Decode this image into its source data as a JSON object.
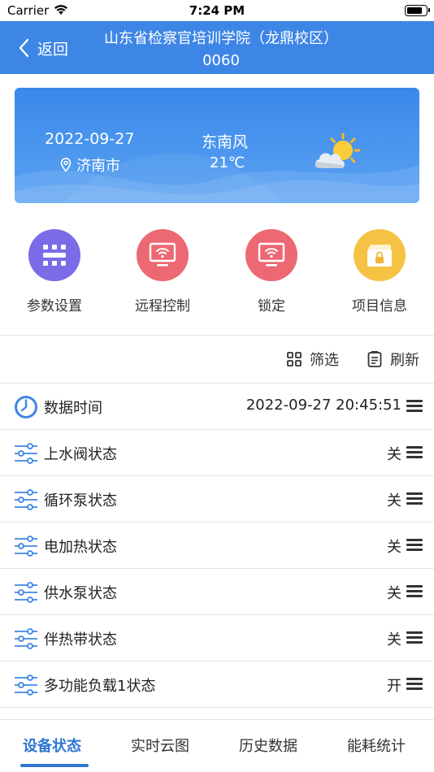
{
  "status_bar": {
    "carrier": "Carrier",
    "time": "7:24 PM",
    "battery_level": 0.85
  },
  "nav": {
    "back_label": "返回",
    "title_line1": "山东省检察官培训学院（龙鼎校区）",
    "title_line2": "0060"
  },
  "weather": {
    "date": "2022-09-27",
    "city": "济南市",
    "wind": "东南风",
    "temperature": "21℃",
    "icon": "partly-cloudy-icon"
  },
  "actions": [
    {
      "label": "参数设置",
      "icon": "grid-settings-icon",
      "color": "#7a6be6"
    },
    {
      "label": "远程控制",
      "icon": "monitor-wifi-icon",
      "color": "#ec6873"
    },
    {
      "label": "锁定",
      "icon": "monitor-wifi-icon",
      "color": "#ec6873"
    },
    {
      "label": "项目信息",
      "icon": "folder-lock-icon",
      "color": "#f6c244"
    }
  ],
  "toolbar": {
    "filter_label": "筛选",
    "refresh_label": "刷新"
  },
  "rows": [
    {
      "label": "数据时间",
      "value": "2022-09-27 20:45:51",
      "icon": "clock-icon"
    },
    {
      "label": "上水阀状态",
      "value": "关",
      "icon": "sliders-icon"
    },
    {
      "label": "循环泵状态",
      "value": "关",
      "icon": "sliders-icon"
    },
    {
      "label": "电加热状态",
      "value": "关",
      "icon": "sliders-icon"
    },
    {
      "label": "供水泵状态",
      "value": "关",
      "icon": "sliders-icon"
    },
    {
      "label": "伴热带状态",
      "value": "关",
      "icon": "sliders-icon"
    },
    {
      "label": "多功能负载1状态",
      "value": "开",
      "icon": "sliders-icon"
    }
  ],
  "tabs": [
    {
      "label": "设备状态",
      "active": true
    },
    {
      "label": "实时云图",
      "active": false
    },
    {
      "label": "历史数据",
      "active": false
    },
    {
      "label": "能耗统计",
      "active": false
    }
  ],
  "colors": {
    "primary": "#3e86e6",
    "tab_active": "#2f76d2",
    "icon_blue": "#3e86e6"
  }
}
